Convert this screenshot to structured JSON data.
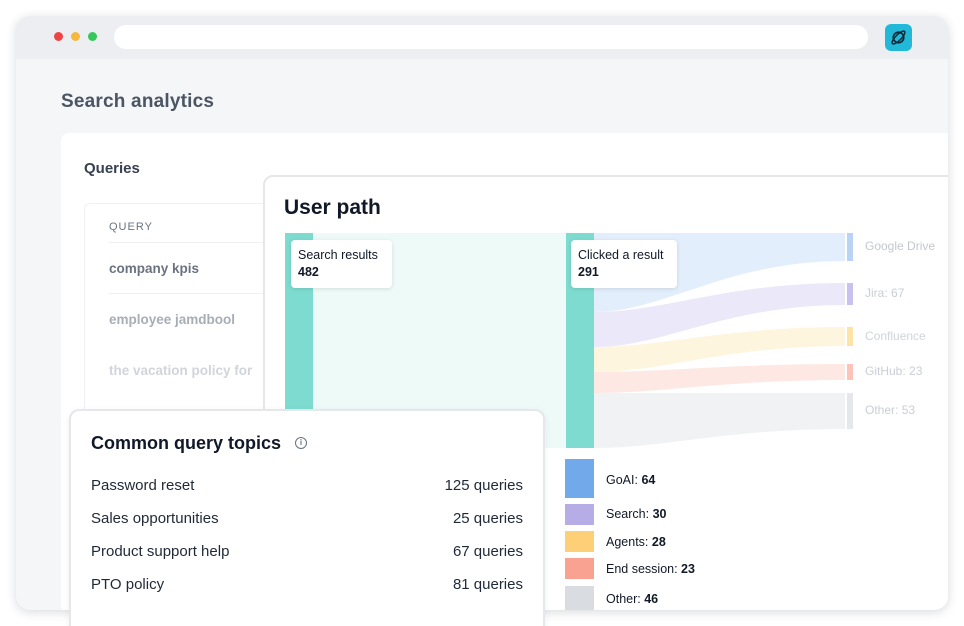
{
  "page": {
    "title": "Search analytics"
  },
  "queries": {
    "title": "Queries",
    "column_header": "QUERY",
    "rows": [
      "company kpis",
      "employee jamdbool",
      "the vacation policy for"
    ]
  },
  "user_path": {
    "title": "User path",
    "nodes": {
      "search_results": {
        "label": "Search results",
        "value": "482"
      },
      "clicked_result": {
        "label": "Clicked a result",
        "value": "291"
      }
    },
    "destinations": [
      {
        "label": "Google Drive",
        "count": "",
        "color": "#b9d3f5"
      },
      {
        "label": "Jira",
        "count": "67",
        "color": "#c9c2f0"
      },
      {
        "label": "Confluence",
        "count": "",
        "color": "#fde3a6"
      },
      {
        "label": "GitHub",
        "count": "23",
        "color": "#fcc3b8"
      },
      {
        "label": "Other",
        "count": "53",
        "color": "#e5e7eb"
      }
    ],
    "outcomes": [
      {
        "label": "GoAI: ",
        "count": "64",
        "color": "#72a9ea"
      },
      {
        "label": "Search: ",
        "count": "30",
        "color": "#b6ace6"
      },
      {
        "label": "Agents: ",
        "count": "28",
        "color": "#fdd077"
      },
      {
        "label": "End session: ",
        "count": "23",
        "color": "#f9a291"
      },
      {
        "label": "Other: ",
        "count": "46",
        "color": "#d9dce1"
      }
    ],
    "accent_color": "#7ddccf"
  },
  "topics": {
    "title": "Common query topics",
    "info_glyph": "i",
    "rows": [
      {
        "name": "Password reset",
        "count": "125 queries"
      },
      {
        "name": "Sales opportunities",
        "count": "25 queries"
      },
      {
        "name": "Product support help",
        "count": "67 queries"
      },
      {
        "name": "PTO policy",
        "count": "81 queries"
      }
    ]
  }
}
